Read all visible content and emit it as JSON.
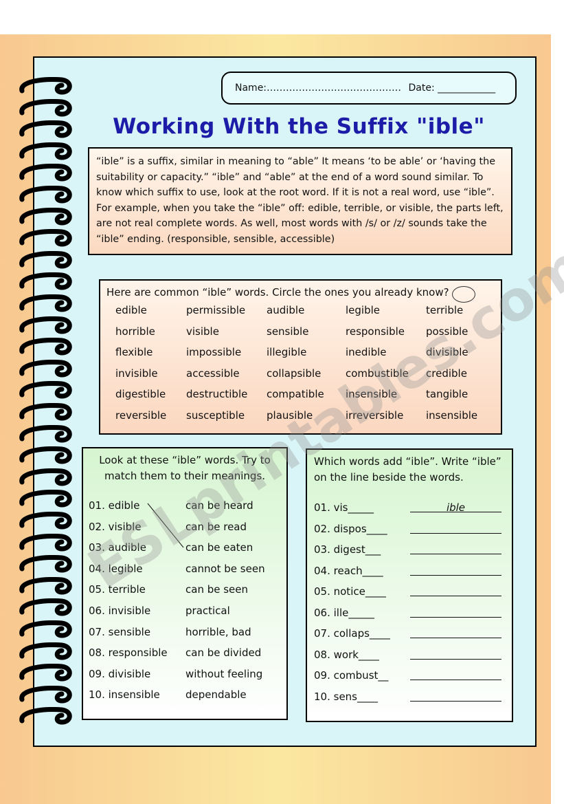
{
  "header": {
    "name_label": "Name:……………………………………",
    "date_label": "Date: ____________"
  },
  "title": "Working With the Suffix \"ible\"",
  "intro": "“ible” is a suffix, similar in meaning to “able” It means ‘to be able’ or ‘having the suitability or capacity.” “ible” and “able” at the end of a word sound similar. To know which suffix to use, look at the root word. If it is not a real word, use “ible”. For example, when you take the “ible” off: edible, terrible, or visible, the parts left, are not real complete words. As well, most words with /s/ or /z/ sounds take the “ible” ending. (responsible, sensible, accessible)",
  "common": {
    "heading": "Here are common “ible” words. Circle the ones you already know?",
    "rows": [
      [
        "edible",
        "permissible",
        "audible",
        "legible",
        "terrible"
      ],
      [
        "horrible",
        "visible",
        "sensible",
        "responsible",
        "possible"
      ],
      [
        "flexible",
        "impossible",
        "illegible",
        "inedible",
        "divisible"
      ],
      [
        "invisible",
        "accessible",
        "collapsible",
        "combustible",
        "credible"
      ],
      [
        "digestible",
        "destructible",
        "compatible",
        "insensible",
        "tangible"
      ],
      [
        "reversible",
        "susceptible",
        "plausible",
        "irreversible",
        "insensible"
      ]
    ]
  },
  "match": {
    "instruction": "Look at these “ible” words. Try to match them to their meanings.",
    "words": [
      "01. edible",
      "02. visible",
      "03. audible",
      "04. legible",
      "05. terrible",
      "06. invisible",
      "07. sensible",
      "08. responsible",
      "09. divisible",
      "10. insensible"
    ],
    "meanings": [
      "can be heard",
      "can be read",
      "can be eaten",
      "cannot be seen",
      "can be seen",
      "practical",
      "horrible, bad",
      "can be divided",
      "without feeling",
      "dependable"
    ]
  },
  "adds": {
    "instruction": "Which words add “ible”. Write “ible” on the line beside the words.",
    "items": [
      "01. vis_____",
      "02. dispos____",
      "03. digest___",
      "04. reach____",
      "05. notice____",
      "06. ille_____",
      "07. collaps____",
      "08. work____",
      "09. combust__",
      "10. sens____"
    ],
    "answers": [
      "ible",
      "",
      "",
      "",
      "",
      "",
      "",
      "",
      "",
      ""
    ]
  },
  "watermark": "ESLprintables.com"
}
